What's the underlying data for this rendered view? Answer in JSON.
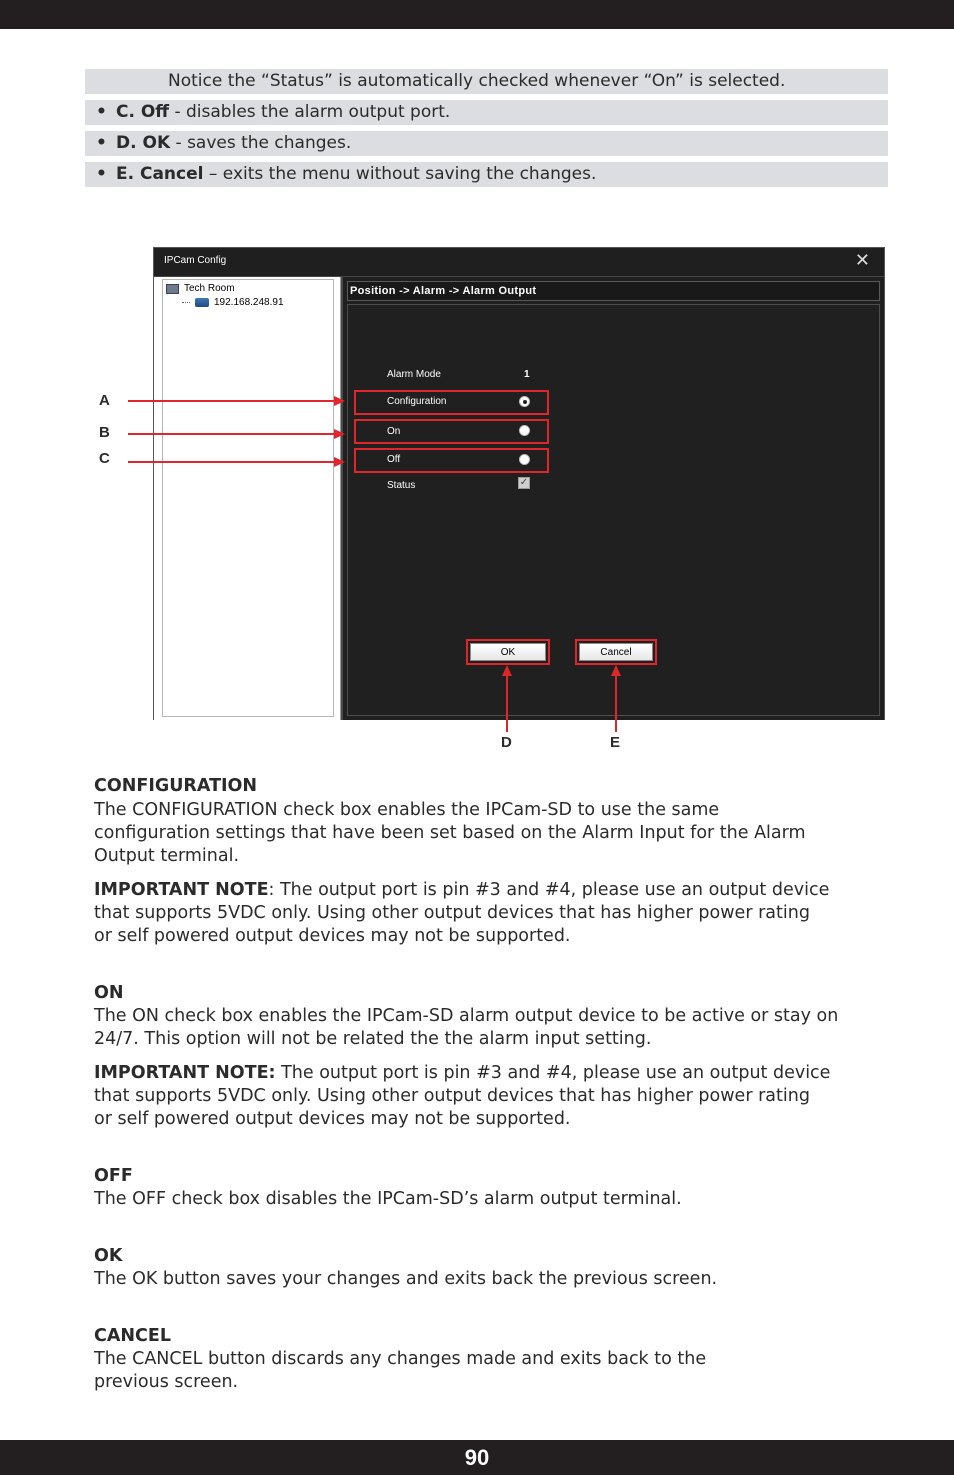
{
  "bullets": {
    "note": "Notice the “Status” is automatically checked whenever “On” is selected.",
    "items": [
      {
        "label": "C. Off",
        "text": " - disables the alarm output port."
      },
      {
        "label": "D. OK",
        "text": " - saves the changes."
      },
      {
        "label": "E. Cancel",
        "text": " – exits the menu without saving the changes."
      }
    ],
    "bullet_glyph": "•"
  },
  "screenshot": {
    "window_title": "IPCam Config",
    "close_glyph": "✕",
    "tree": {
      "root": "Tech Room",
      "child": "192.168.248.91"
    },
    "path": "Position -> Alarm -> Alarm Output",
    "alarm_mode_label": "Alarm Mode",
    "alarm_mode_value": "1",
    "options": {
      "configuration": "Configuration",
      "on": "On",
      "off": "Off",
      "status": "Status"
    },
    "status_checked": true,
    "ok_label": "OK",
    "cancel_label": "Cancel",
    "checkmark_glyph": "✓"
  },
  "callouts": {
    "a": "A",
    "b": "B",
    "c": "C",
    "d": "D",
    "e": "E"
  },
  "sections": {
    "configuration": {
      "heading": "CONFIGURATION",
      "line1": "The CONFIGURATION check box enables the IPCam-SD to use the same",
      "line2": "configuration settings that have been set based on the Alarm Input for the Alarm",
      "line3": "Output terminal."
    },
    "note1": {
      "label": "IMPORTANT NOTE",
      "text1": ":  The output port is pin #3 and #4, please use an output device",
      "line2": "that supports 5VDC only.  Using other output devices that has higher power rating",
      "line3": "or self powered output devices may not be supported."
    },
    "on": {
      "heading": "ON",
      "line1": "The ON check box enables the IPCam-SD alarm output device to be active or stay on",
      "line2": "24/7. This option will not be related the the alarm input setting."
    },
    "note2": {
      "label": "IMPORTANT NOTE:",
      "text1": "  The output port is pin #3 and #4, please use an output device",
      "line2": "that supports 5VDC only.  Using other output devices that has higher power rating",
      "line3": "or self powered output devices may not be supported."
    },
    "off": {
      "heading": "OFF",
      "line1": "The OFF check box disables the IPCam-SD’s alarm output terminal."
    },
    "ok": {
      "heading": "OK",
      "line1": "The OK button saves your changes and exits back the previous screen."
    },
    "cancel": {
      "heading": "CANCEL",
      "line1": "The CANCEL button discards any changes made and exits back to the",
      "line2": "previous screen."
    }
  },
  "page_number": "90",
  "colors": {
    "accent_red": "#e0262a",
    "bar_dark": "#231f20",
    "bullet_bg": "#dcdde1"
  }
}
